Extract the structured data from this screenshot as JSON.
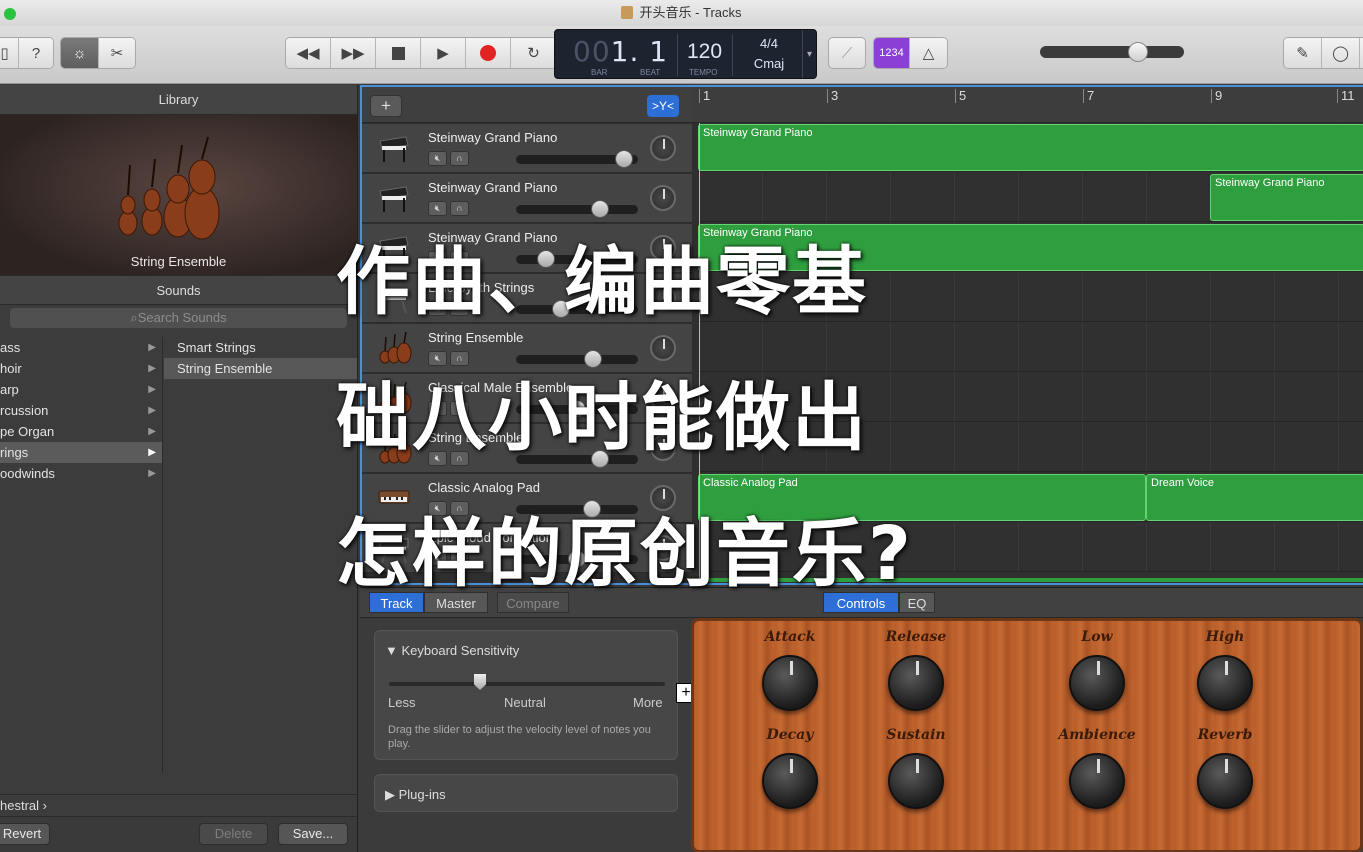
{
  "window": {
    "title": "开头音乐 - Tracks"
  },
  "toolbar": {
    "lcd_bar": "00",
    "lcd_beat_value": "1. 1",
    "bar_label": "BAR",
    "beat_label": "BEAT",
    "tempo": "120",
    "tempo_label": "TEMPO",
    "time_signature": "4/4",
    "key": "Cmaj",
    "count_in": "1234",
    "colors": {
      "record": "#e02424",
      "count_in": "#8b3fd4"
    }
  },
  "library": {
    "header": "Library",
    "selected_patch": "String Ensemble",
    "sounds_header": "Sounds",
    "search_placeholder": "Search Sounds",
    "categories": [
      {
        "label": "ass"
      },
      {
        "label": "hoir"
      },
      {
        "label": "arp"
      },
      {
        "label": "rcussion"
      },
      {
        "label": "pe Organ"
      },
      {
        "label": "rings"
      },
      {
        "label": "oodwinds"
      }
    ],
    "selected_category_index": 5,
    "patches": [
      {
        "label": "Smart Strings"
      },
      {
        "label": "String Ensemble"
      }
    ],
    "path": "hestral",
    "revert_label": "Revert",
    "delete_label": "Delete",
    "save_label": "Save..."
  },
  "ruler": {
    "marks": [
      "1",
      "3",
      "5",
      "7",
      "9",
      "11"
    ]
  },
  "tracks": [
    {
      "name": "Steinway Grand Piano",
      "icon": "piano-icon",
      "volume": 0.95
    },
    {
      "name": "Steinway Grand Piano",
      "icon": "piano-icon",
      "volume": 0.72
    },
    {
      "name": "Steinway Grand Piano",
      "icon": "piano-icon",
      "volume": 0.2
    },
    {
      "name": "Epic Synth Strings",
      "icon": "synth-icon",
      "volume": 0.35
    },
    {
      "name": "String Ensemble",
      "icon": "violin-icon",
      "volume": 0.65
    },
    {
      "name": "Classical Male Ensemble",
      "icon": "violin-icon",
      "volume": 0.5
    },
    {
      "name": "String Ensemble",
      "icon": "violin-icon",
      "volume": 0.72
    },
    {
      "name": "Classic Analog Pad",
      "icon": "keyboard-icon",
      "volume": 0.64
    },
    {
      "name": "Epic Cloud Formation",
      "icon": "synth-icon",
      "volume": 0.5
    }
  ],
  "regions": [
    {
      "label": "Steinway Grand Piano"
    },
    {
      "label": "Steinway Grand Piano"
    },
    {
      "label": "Steinway Grand Piano"
    },
    {
      "label": "Classic Analog Pad"
    },
    {
      "label": "Dream Voice"
    }
  ],
  "editor": {
    "tab_track": "Track",
    "tab_master": "Master",
    "tab_compare": "Compare",
    "tab_controls": "Controls",
    "tab_eq": "EQ",
    "keyboard_sensitivity": "Keyboard Sensitivity",
    "less": "Less",
    "neutral": "Neutral",
    "more": "More",
    "help": "Drag the slider to adjust the velocity level of notes you play.",
    "sensitivity_value": 0.33,
    "plugins": "Plug-ins",
    "knobs": [
      "Attack",
      "Release",
      "Low",
      "High",
      "Decay",
      "Sustain",
      "Ambience",
      "Reverb"
    ]
  },
  "overlay": {
    "lines": [
      "作曲、编曲零基",
      "础八小时能做出",
      "怎样的原创音乐?"
    ]
  }
}
